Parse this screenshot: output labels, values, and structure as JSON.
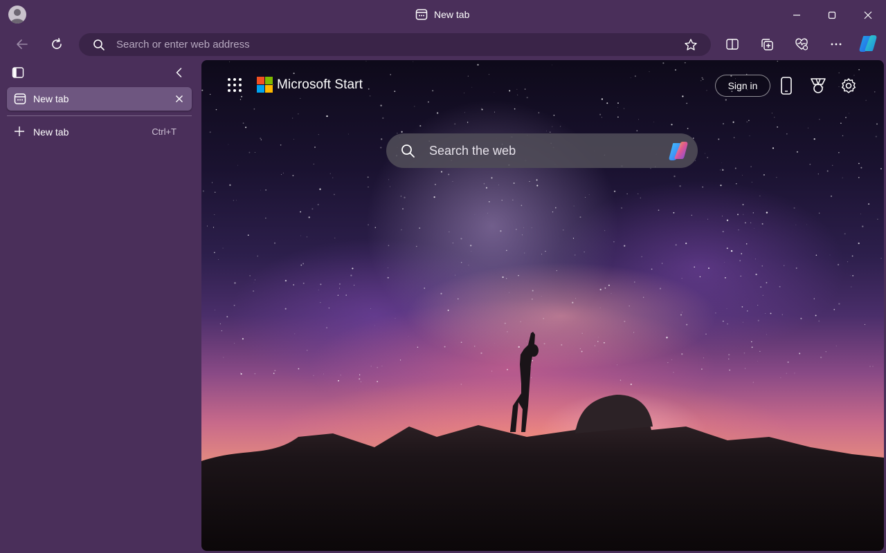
{
  "window": {
    "title": "New tab",
    "controls": [
      "minimize-icon",
      "maximize-icon",
      "close-icon"
    ]
  },
  "toolbar": {
    "address_placeholder": "Search or enter web address",
    "buttons": [
      "back-icon",
      "refresh-icon",
      "favorite-star-icon",
      "split-screen-icon",
      "collections-icon",
      "browser-essentials-icon",
      "more-icon",
      "copilot-icon"
    ]
  },
  "sidebar": {
    "active_tab_label": "New tab",
    "new_tab_label": "New tab",
    "new_tab_shortcut": "Ctrl+T"
  },
  "page": {
    "brand": "Microsoft Start",
    "sign_in": "Sign in",
    "search_placeholder": "Search the web",
    "header_icons": [
      "apps-grid-icon",
      "phone-icon",
      "rewards-icon",
      "settings-icon"
    ]
  },
  "colors": {
    "frame": "#4a2f5a",
    "address_bar": "#3a2448",
    "active_tab": "#6e5680",
    "ms_red": "#f25022",
    "ms_green": "#7fba00",
    "ms_blue": "#00a4ef",
    "ms_yellow": "#ffb900"
  }
}
